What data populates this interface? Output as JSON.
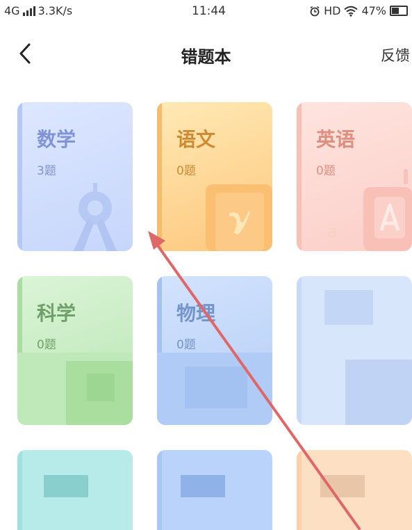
{
  "status_bar": {
    "network": "4G",
    "speed": "3.3K/s",
    "time": "11:44",
    "hd": "HD",
    "battery": "47%"
  },
  "nav": {
    "title": "错题本",
    "feedback": "反馈"
  },
  "subjects": [
    {
      "title": "数学",
      "count": "3题"
    },
    {
      "title": "语文",
      "count": "0题"
    },
    {
      "title": "英语",
      "count": "0题"
    },
    {
      "title": "科学",
      "count": "0题"
    },
    {
      "title": "物理",
      "count": "0题"
    }
  ],
  "icons": {
    "back": "chevron-left-icon",
    "alarm": "alarm-clock-icon",
    "wifi": "wifi-icon",
    "battery": "battery-icon",
    "signal": "signal-bars-icon"
  },
  "colors": {
    "annotation_arrow": "#e06767"
  }
}
